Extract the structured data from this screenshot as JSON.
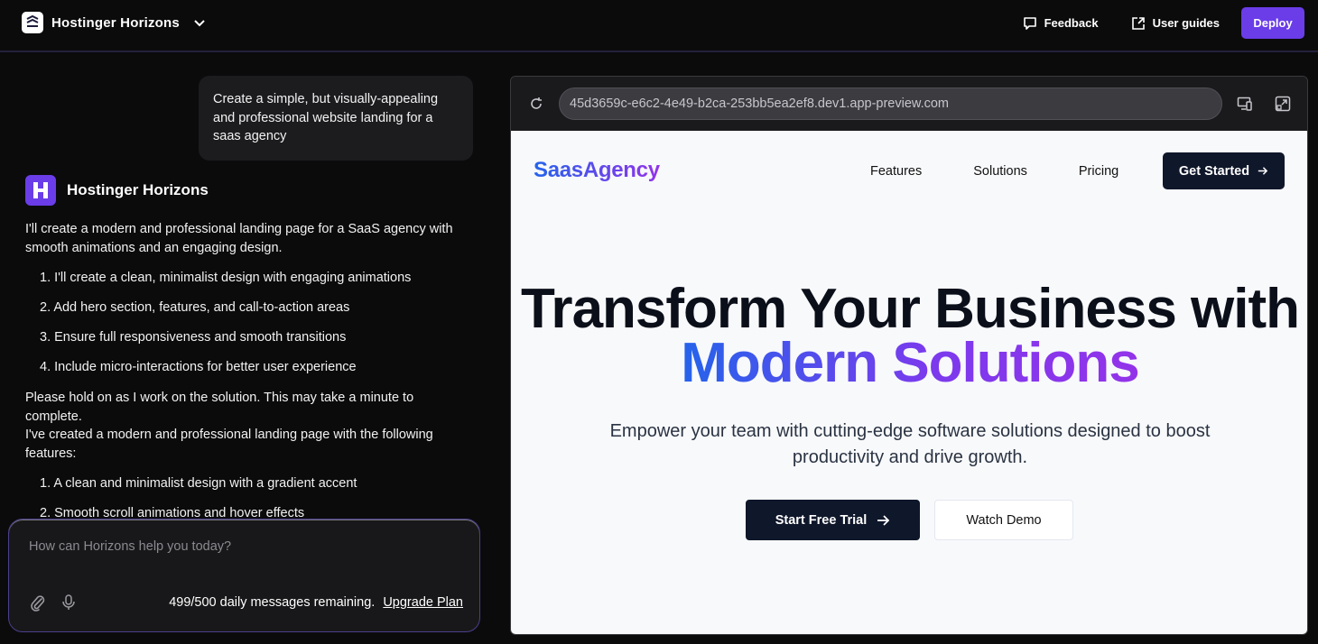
{
  "topbar": {
    "app_name": "Hostinger Horizons",
    "feedback_label": "Feedback",
    "user_guides_label": "User guides",
    "deploy_label": "Deploy"
  },
  "chat": {
    "user_message": "Create a simple, but visually-appealing and professional website landing for a saas agency",
    "assistant_name": "Hostinger Horizons",
    "intro": "I'll create a modern and professional landing page for a SaaS agency with smooth animations and an engaging design.",
    "plan_items": [
      "1. I'll create a clean, minimalist design with engaging animations",
      "2. Add hero section, features, and call-to-action areas",
      "3. Ensure full responsiveness and smooth transitions",
      "4. Include micro-interactions for better user experience"
    ],
    "hold_on": "Please hold on as I work on the solution. This may take a minute to complete.",
    "created": "I've created a modern and professional landing page with the following features:",
    "feature_items": [
      "1. A clean and minimalist design with a gradient accent",
      "2. Smooth scroll animations and hover effects"
    ]
  },
  "composer": {
    "placeholder": "How can Horizons help you today?",
    "value": "",
    "quota_text": "499/500 daily messages remaining.",
    "upgrade_label": "Upgrade Plan"
  },
  "preview": {
    "url": "45d3659c-e6c2-4e49-b2ca-253bb5ea2ef8.dev1.app-preview.com",
    "site": {
      "logo": "SaasAgency",
      "nav": [
        "Features",
        "Solutions",
        "Pricing"
      ],
      "get_started": "Get Started",
      "hero_line1": "Transform Your Business with",
      "hero_line2": "Modern Solutions",
      "subtitle": "Empower your team with cutting-edge software solutions designed to boost productivity and drive growth.",
      "primary_cta": "Start Free Trial",
      "secondary_cta": "Watch Demo"
    }
  },
  "colors": {
    "accent": "#6a3de8",
    "gradient_start": "#2563eb",
    "gradient_end": "#9333ea",
    "dark_button": "#0f172a"
  }
}
